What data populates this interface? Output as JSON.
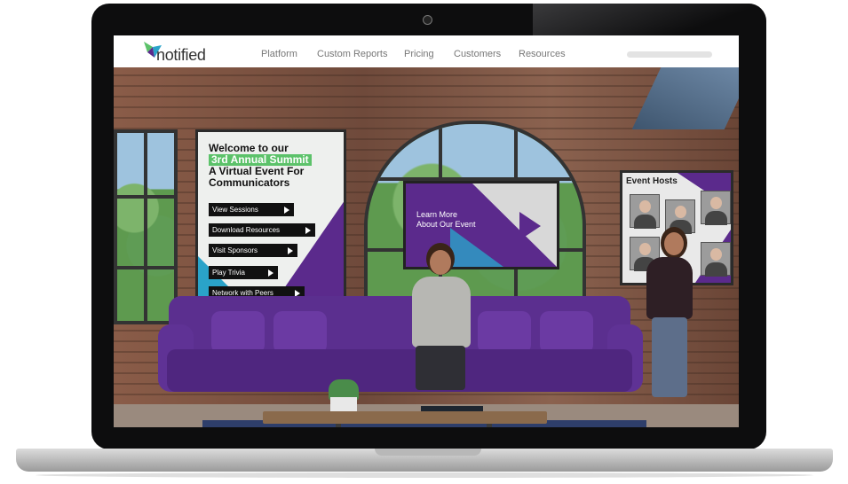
{
  "nav": {
    "logo_text": "notified",
    "items": [
      "Platform",
      "Custom Reports",
      "Pricing",
      "Customers",
      "Resources"
    ]
  },
  "welcome": {
    "line1": "Welcome to our",
    "highlight": "3rd Annual Summit",
    "line2": "A Virtual Event For",
    "line3": "Communicators",
    "buttons": [
      "View Sessions",
      "Download Resources",
      "Visit Sponsors",
      "Play Trivia",
      "Network with Peers"
    ]
  },
  "learn": {
    "text": "Learn More About Our Event"
  },
  "hosts": {
    "title": "Event Hosts"
  },
  "colors": {
    "purple": "#5b2a8c",
    "cyan": "#2aa3c9",
    "green": "#5cc26a"
  }
}
